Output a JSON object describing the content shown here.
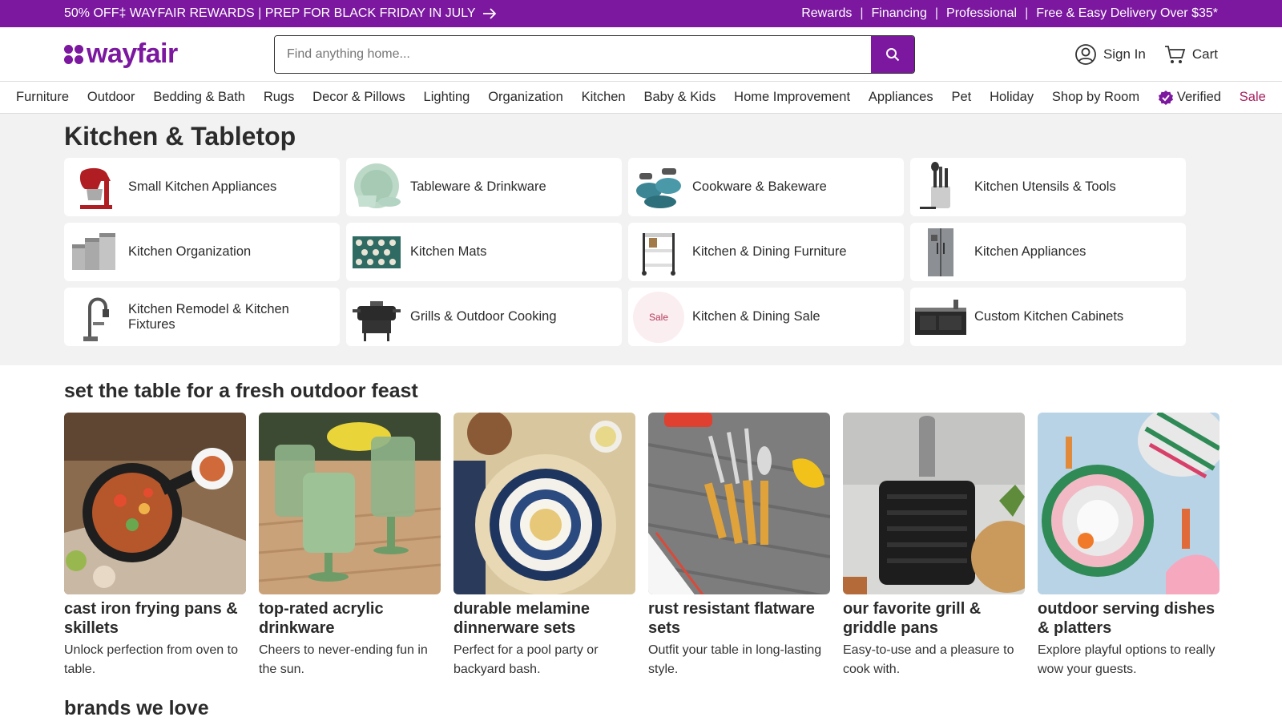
{
  "promo": {
    "left_text": "50% OFF‡ WAYFAIR REWARDS | PREP FOR BLACK FRIDAY IN JULY",
    "links": [
      "Rewards",
      "Financing",
      "Professional",
      "Free & Easy Delivery Over $35*"
    ]
  },
  "header": {
    "logo_text": "wayfair",
    "search_placeholder": "Find anything home...",
    "sign_in": "Sign In",
    "cart": "Cart"
  },
  "nav": [
    "Furniture",
    "Outdoor",
    "Bedding & Bath",
    "Rugs",
    "Decor & Pillows",
    "Lighting",
    "Organization",
    "Kitchen",
    "Baby & Kids",
    "Home Improvement",
    "Appliances",
    "Pet",
    "Holiday",
    "Shop by Room",
    "Verified",
    "Sale"
  ],
  "categories": {
    "title": "Kitchen & Tabletop",
    "items": [
      {
        "label": "Small Kitchen Appliances",
        "icon": "stand-mixer-icon"
      },
      {
        "label": "Tableware & Drinkware",
        "icon": "plates-icon"
      },
      {
        "label": "Cookware & Bakeware",
        "icon": "pots-icon"
      },
      {
        "label": "Kitchen Utensils & Tools",
        "icon": "utensils-icon"
      },
      {
        "label": "Kitchen Organization",
        "icon": "canisters-icon"
      },
      {
        "label": "Kitchen Mats",
        "icon": "mat-icon"
      },
      {
        "label": "Kitchen & Dining Furniture",
        "icon": "cart-icon"
      },
      {
        "label": "Kitchen Appliances",
        "icon": "fridge-icon"
      },
      {
        "label": "Kitchen Remodel & Kitchen Fixtures",
        "icon": "faucet-icon"
      },
      {
        "label": "Grills & Outdoor Cooking",
        "icon": "grill-icon"
      },
      {
        "label": "Kitchen & Dining Sale",
        "icon": "sale-icon",
        "badge": "Sale"
      },
      {
        "label": "Custom Kitchen Cabinets",
        "icon": "cabinet-icon"
      }
    ]
  },
  "features": {
    "title": "set the table for a fresh outdoor feast",
    "items": [
      {
        "name": "cast iron frying pans & skillets",
        "desc": "Unlock perfection from oven to table."
      },
      {
        "name": "top-rated acrylic drinkware",
        "desc": "Cheers to never-ending fun in the sun."
      },
      {
        "name": "durable melamine dinnerware sets",
        "desc": "Perfect for a pool party or backyard bash."
      },
      {
        "name": "rust resistant flatware sets",
        "desc": "Outfit your table in long-lasting style."
      },
      {
        "name": "our favorite grill & griddle pans",
        "desc": "Easy-to-use and a pleasure to cook with."
      },
      {
        "name": "outdoor serving dishes & platters",
        "desc": "Explore playful options to really wow your guests."
      }
    ]
  },
  "brands": {
    "title": "brands we love"
  },
  "colors": {
    "brand": "#7b189f",
    "sale": "#a8205f",
    "section_bg": "#f2f2f2"
  }
}
